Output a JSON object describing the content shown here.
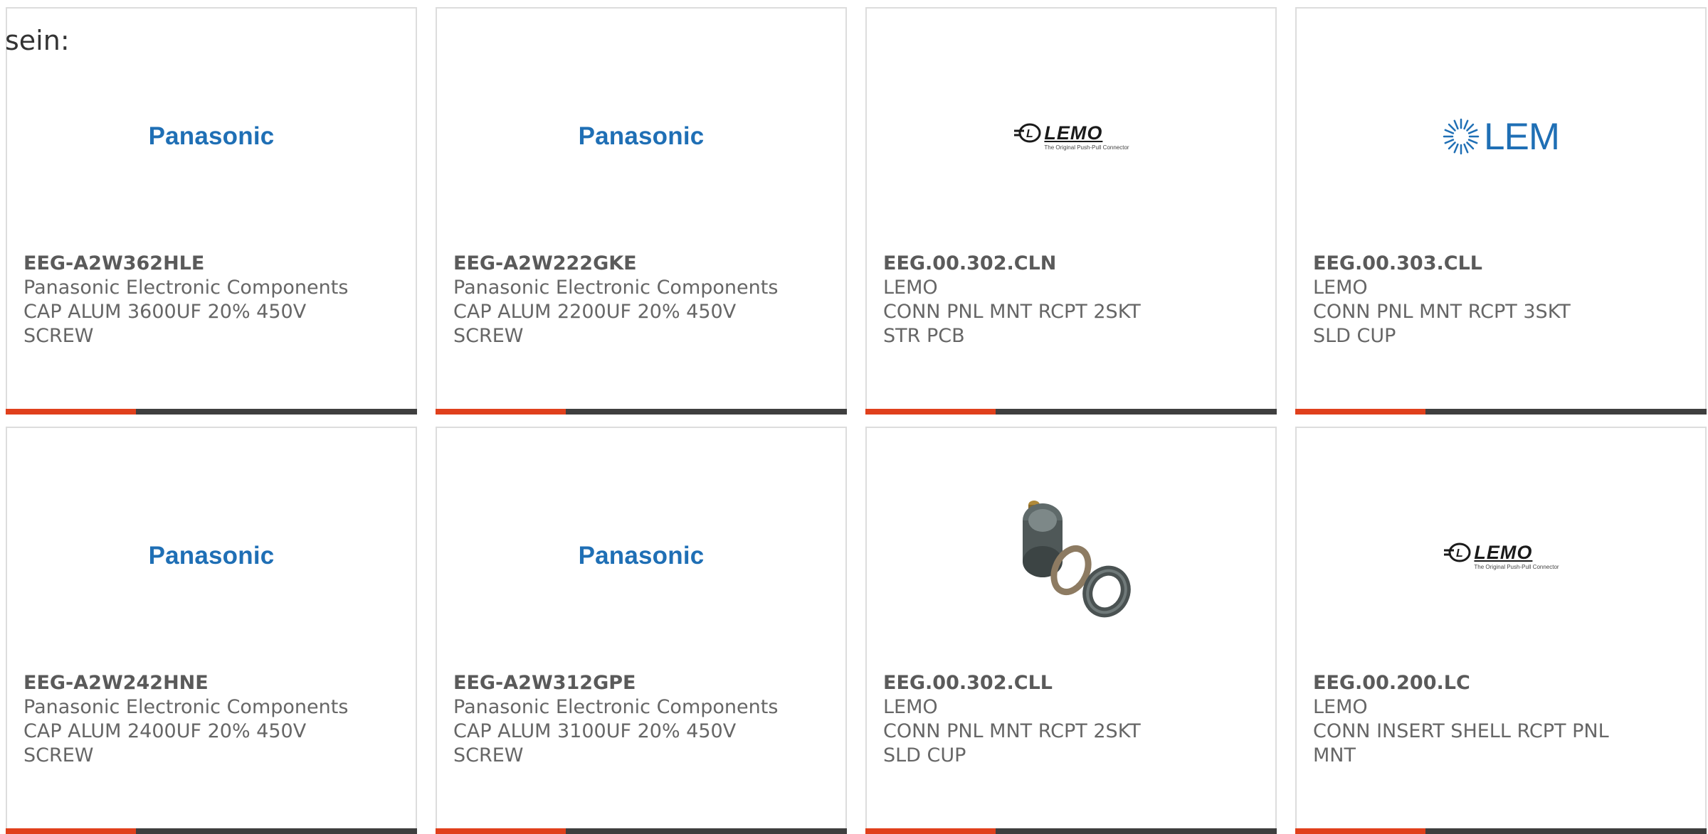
{
  "intro_text": "sein:",
  "colors": {
    "accent_orange": "#e0401c",
    "accent_dark": "#3f3f3f",
    "text": "#666666",
    "panasonic_blue": "#1f6fb5"
  },
  "logos": {
    "panasonic": "Panasonic",
    "lemo": "LEMO",
    "lemo_tagline": "The Original Push-Pull Connector",
    "lem": "LEM"
  },
  "products": [
    {
      "part": "EEG-A2W362HLE",
      "maker": "Panasonic Electronic Components",
      "desc": "CAP ALUM 3600UF 20% 450V SCREW",
      "image": "panasonic-logo"
    },
    {
      "part": "EEG-A2W222GKE",
      "maker": "Panasonic Electronic Components",
      "desc": "CAP ALUM 2200UF 20% 450V SCREW",
      "image": "panasonic-logo"
    },
    {
      "part": "EEG.00.302.CLN",
      "maker": "LEMO",
      "desc": "CONN PNL MNT RCPT 2SKT STR PCB",
      "image": "lemo-logo"
    },
    {
      "part": "EEG.00.303.CLL",
      "maker": "LEMO",
      "desc": "CONN PNL MNT RCPT 3SKT SLD CUP",
      "image": "lem-logo"
    },
    {
      "part": "EEG-A2W242HNE",
      "maker": "Panasonic Electronic Components",
      "desc": "CAP ALUM 2400UF 20% 450V SCREW",
      "image": "panasonic-logo"
    },
    {
      "part": "EEG-A2W312GPE",
      "maker": "Panasonic Electronic Components",
      "desc": "CAP ALUM 3100UF 20% 450V SCREW",
      "image": "panasonic-logo"
    },
    {
      "part": "EEG.00.302.CLL",
      "maker": "LEMO",
      "desc": "CONN PNL MNT RCPT 2SKT SLD CUP",
      "image": "connector-photo"
    },
    {
      "part": "EEG.00.200.LC",
      "maker": "LEMO",
      "desc": "CONN INSERT SHELL RCPT PNL MNT",
      "image": "lemo-logo"
    }
  ]
}
